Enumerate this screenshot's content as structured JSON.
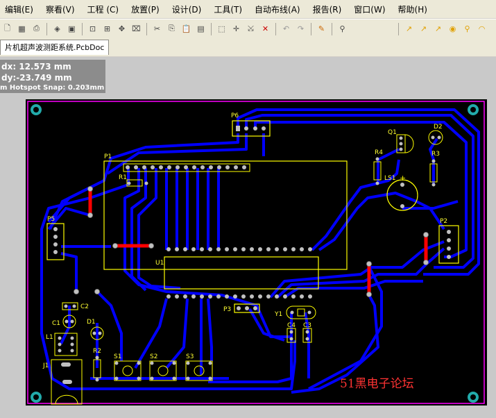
{
  "menu": [
    "编辑(E)",
    "察看(V)",
    "工程 (C)",
    "放置(P)",
    "设计(D)",
    "工具(T)",
    "自动布线(A)",
    "报告(R)",
    "窗口(W)",
    "帮助(H)"
  ],
  "document_tab": "片机超声波测距系统.PcbDoc",
  "hud": {
    "dx": "dx: 12.573 mm",
    "dy": "dy:-23.749 mm",
    "snap": "m Hotspot Snap: 0.203mm"
  },
  "components": {
    "P1": "P1",
    "P2": "P2",
    "P3": "P3",
    "P5": "P5",
    "P6": "P6",
    "U1": "U1",
    "R1": "R1",
    "R2": "R2",
    "R3": "R3",
    "R4": "R4",
    "Q1": "Q1",
    "D1": "D1",
    "D2": "D2",
    "LS1": "LS1",
    "Y1": "Y1",
    "C1": "C1",
    "C2": "C2",
    "C3": "C3",
    "C4": "C4",
    "L1": "L1",
    "J1": "J1",
    "S1": "S1",
    "S2": "S2",
    "S3": "S3"
  },
  "watermark": "51黑电子论坛",
  "colors": {
    "board": "#000000",
    "outline": "#ff00ff",
    "bottom_layer": "#0000ff",
    "top_layer": "#ff0000",
    "overlay": "#ffff00",
    "pad": "#c0c0c0",
    "watermark": "#ff3333"
  },
  "icons": [
    "new-icon",
    "open-icon",
    "print-icon",
    "layers-icon",
    "board-icon",
    "zoom-fit-icon",
    "zoom-area-icon",
    "pan-icon",
    "cut-icon",
    "copy-icon",
    "paste-icon",
    "stamp-icon",
    "select-rect-icon",
    "move-icon",
    "align-icon",
    "clear-icon",
    "undo-icon",
    "redo-icon",
    "pen-icon",
    "inspect-icon",
    "route-icon",
    "route2-icon",
    "route3-icon",
    "pad-icon",
    "via-icon",
    "arc-icon"
  ]
}
